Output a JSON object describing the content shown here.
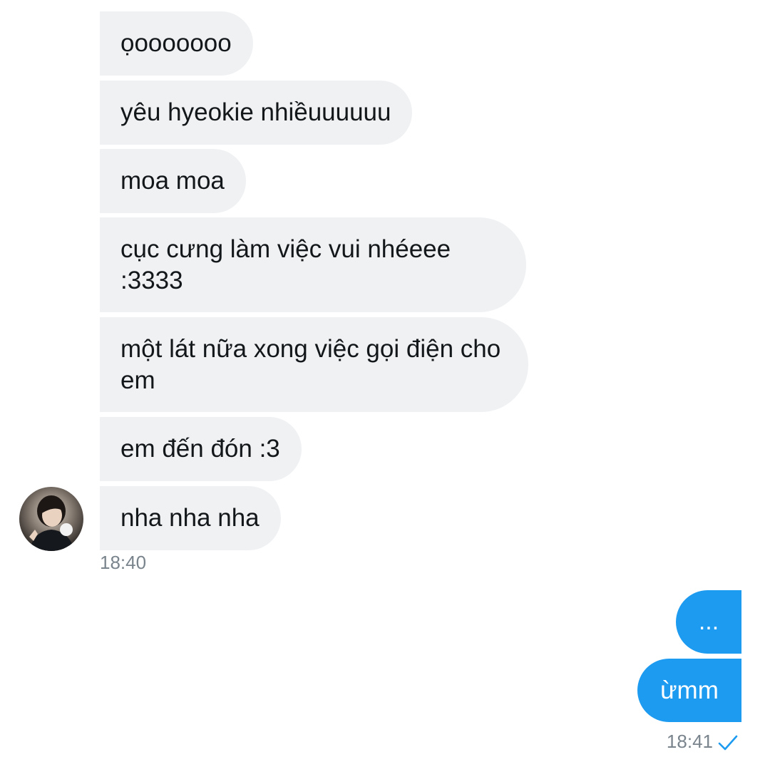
{
  "conversation": {
    "incoming": [
      {
        "text": "ọooooooo"
      },
      {
        "text": "yêu hyeokie nhiềuuuuuu"
      },
      {
        "text": "moa moa"
      },
      {
        "text": "cục cưng làm việc vui nhéeee :3333"
      },
      {
        "text": "một lát nữa xong việc gọi điện cho em"
      },
      {
        "text": "em đến đón :3"
      },
      {
        "text": "nha nha nha"
      }
    ],
    "incoming_time": "18:40",
    "outgoing": [
      {
        "text": "..."
      },
      {
        "text": "ừmm"
      }
    ],
    "outgoing_time": "18:41",
    "outgoing_status": "check-icon"
  },
  "colors": {
    "incoming_bubble": "#eff1f3",
    "outgoing_bubble": "#1d9bf0",
    "timestamp": "#7a848d",
    "check": "#1d9bf0"
  }
}
